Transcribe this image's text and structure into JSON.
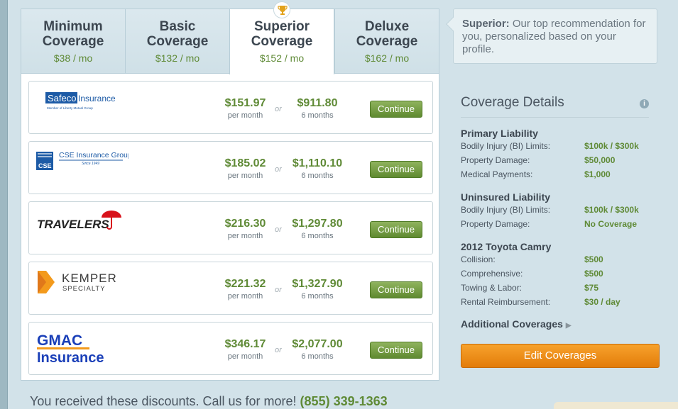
{
  "tabs": [
    {
      "line1": "Minimum",
      "line2": "Coverage",
      "price": "$38 / mo"
    },
    {
      "line1": "Basic",
      "line2": "Coverage",
      "price": "$132 / mo"
    },
    {
      "line1": "Superior",
      "line2": "Coverage",
      "price": "$152 / mo"
    },
    {
      "line1": "Deluxe",
      "line2": "Coverage",
      "price": "$162 / mo"
    }
  ],
  "quotes": [
    {
      "company": "Safeco Insurance",
      "monthly": "$151.97",
      "monthly_label": "per month",
      "or": "or",
      "semiannual": "$911.80",
      "semiannual_label": "6 months",
      "button": "Continue"
    },
    {
      "company": "CSE Insurance Group",
      "monthly": "$185.02",
      "monthly_label": "per month",
      "or": "or",
      "semiannual": "$1,110.10",
      "semiannual_label": "6 months",
      "button": "Continue"
    },
    {
      "company": "TRAVELERS",
      "monthly": "$216.30",
      "monthly_label": "per month",
      "or": "or",
      "semiannual": "$1,297.80",
      "semiannual_label": "6 months",
      "button": "Continue"
    },
    {
      "company": "KEMPER SPECIALTY",
      "monthly": "$221.32",
      "monthly_label": "per month",
      "or": "or",
      "semiannual": "$1,327.90",
      "semiannual_label": "6 months",
      "button": "Continue"
    },
    {
      "company": "GMAC Insurance",
      "monthly": "$346.17",
      "monthly_label": "per month",
      "or": "or",
      "semiannual": "$2,077.00",
      "semiannual_label": "6 months",
      "button": "Continue"
    }
  ],
  "logos": {
    "safeco_name": "Safeco",
    "safeco_word": "Insurance",
    "safeco_sub": "Member of Liberty Mutual Group",
    "cse_name": "CSE Insurance Group",
    "cse_since": "Since 1949",
    "cse_mark": "CSE",
    "travelers": "TRAVELERS",
    "kemper_top": "KEMPER",
    "kemper_bottom": "SPECIALTY",
    "gmac_top": "GMAC",
    "gmac_bottom": "Insurance"
  },
  "discounts": {
    "text": "You received these discounts. Call us for more!",
    "phone": "(855) 339-1363"
  },
  "callout": {
    "bold": "Superior:",
    "text": " Our top recommendation for you, personalized based on your profile."
  },
  "details": {
    "title": "Coverage Details",
    "info": "i",
    "sections": [
      {
        "title": "Primary Liability",
        "rows": [
          {
            "k": "Bodily Injury (BI) Limits:",
            "v": "$100k / $300k"
          },
          {
            "k": "Property Damage:",
            "v": "$50,000"
          },
          {
            "k": "Medical Payments:",
            "v": "$1,000"
          }
        ]
      },
      {
        "title": "Uninsured Liability",
        "rows": [
          {
            "k": "Bodily Injury (BI) Limits:",
            "v": "$100k / $300k"
          },
          {
            "k": "Property Damage:",
            "v": "No Coverage"
          }
        ]
      },
      {
        "title": "2012 Toyota Camry",
        "rows": [
          {
            "k": "Collision:",
            "v": "$500"
          },
          {
            "k": "Comprehensive:",
            "v": "$500"
          },
          {
            "k": "Towing & Labor:",
            "v": "$75"
          },
          {
            "k": "Rental Reimbursement:",
            "v": "$30 / day"
          }
        ]
      }
    ],
    "additional": "Additional Coverages",
    "edit_button": "Edit Coverages"
  },
  "colors": {
    "accent_green": "#5f8a36",
    "button_orange": "#ef8f1a",
    "background": "#d2e2e9"
  },
  "icons": {
    "trophy": "trophy-icon",
    "info": "info-icon",
    "triangle": "triangle-right-icon"
  }
}
